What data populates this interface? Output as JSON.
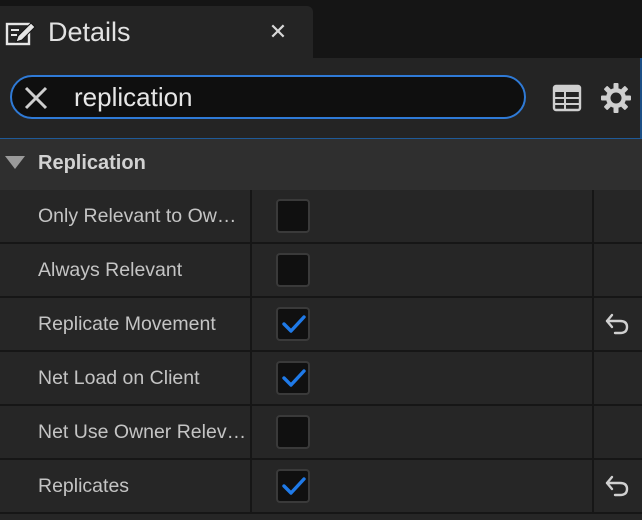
{
  "tab": {
    "title": "Details",
    "icon": "details-pencil-icon",
    "close_glyph": "✕"
  },
  "search": {
    "value": "replication",
    "placeholder": "Search",
    "clear_icon": "clear-x-icon"
  },
  "toolbar": {
    "table_view_icon": "property-matrix-icon",
    "settings_icon": "gear-icon"
  },
  "section": {
    "title": "Replication",
    "expanded": true
  },
  "properties": [
    {
      "label": "Only Relevant to Ow…",
      "checked": false,
      "modified": false
    },
    {
      "label": "Always Relevant",
      "checked": false,
      "modified": false
    },
    {
      "label": "Replicate Movement",
      "checked": true,
      "modified": true
    },
    {
      "label": "Net Load on Client",
      "checked": true,
      "modified": false
    },
    {
      "label": "Net Use Owner Relev…",
      "checked": false,
      "modified": false
    },
    {
      "label": "Replicates",
      "checked": true,
      "modified": true
    }
  ],
  "colors": {
    "accent": "#2f7ad6",
    "check": "#1f7ae8",
    "panel": "#262626",
    "header": "#2f2f2f"
  }
}
